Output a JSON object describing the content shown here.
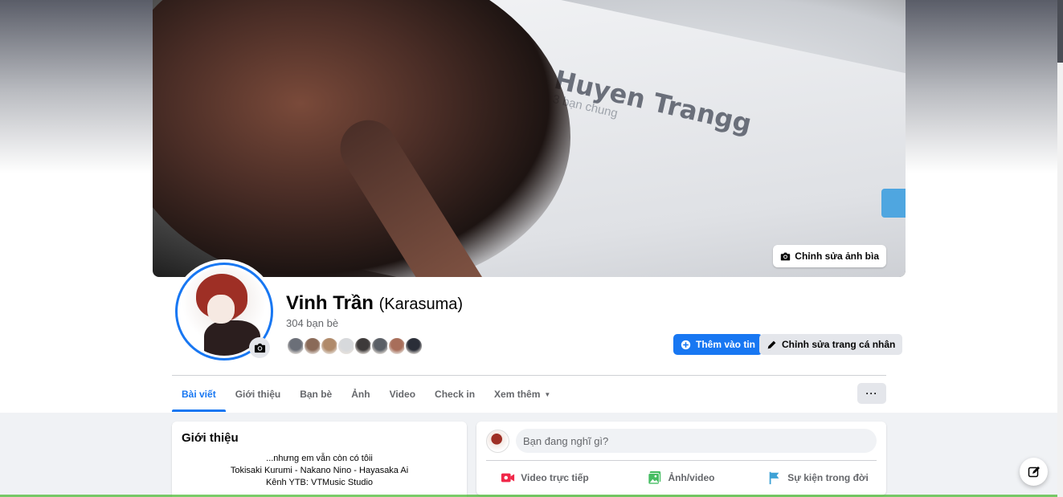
{
  "cover": {
    "edit_label": "Chỉnh sửa ảnh bìa",
    "screen_name_text": "Huyen Trangg",
    "screen_subtext": "3 bạn chung"
  },
  "profile": {
    "name": "Vinh Trần",
    "alt_name": "(Karasuma)",
    "friends_count": "304 bạn bè",
    "friend_avatar_colors": [
      "#6b6f78",
      "#8a6a58",
      "#b08a6a",
      "#d7d9dc",
      "#3d3a3a",
      "#5a5f66",
      "#a86e5a",
      "#2a2e38"
    ]
  },
  "actions": {
    "add_story": "Thêm vào tin",
    "edit_profile": "Chỉnh sửa trang cá nhân"
  },
  "tabs": [
    {
      "label": "Bài viết",
      "active": true
    },
    {
      "label": "Giới thiệu"
    },
    {
      "label": "Bạn bè"
    },
    {
      "label": "Ảnh"
    },
    {
      "label": "Video"
    },
    {
      "label": "Check in"
    },
    {
      "label": "Xem thêm",
      "dropdown": true
    }
  ],
  "more_label": "···",
  "intro": {
    "title": "Giới thiệu",
    "lines": [
      "...nhưng em vẫn còn có tôii",
      "Tokisaki Kurumi - Nakano Nino - Hayasaka Ai",
      "Kênh YTB: VTMusic Studio"
    ]
  },
  "composer": {
    "placeholder": "Bạn đang nghĩ gì?",
    "live_label": "Video trực tiếp",
    "photo_label": "Ảnh/video",
    "event_label": "Sự kiện trong đời"
  },
  "colors": {
    "primary": "#1877f2",
    "secondary_bg": "#e4e6eb",
    "live_red": "#f02849",
    "photo_green": "#45bd62",
    "event_blue": "#3ea2d6"
  }
}
